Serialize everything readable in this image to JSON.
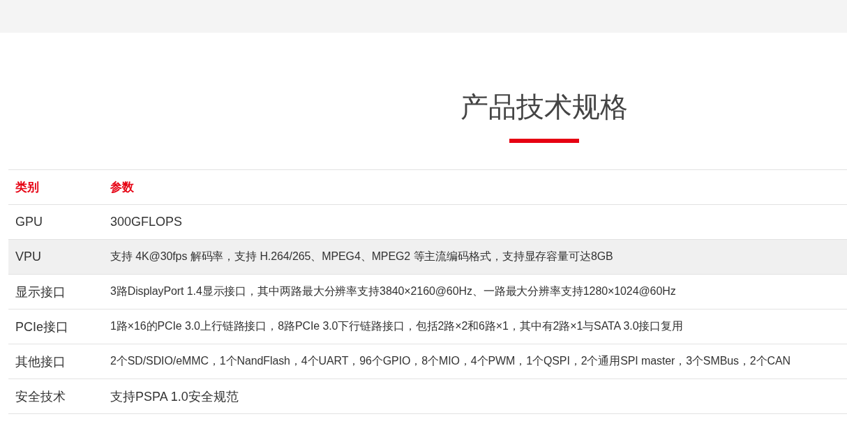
{
  "title": "产品技术规格",
  "table": {
    "columns": [
      "类别",
      "参数"
    ],
    "rows": [
      {
        "category": "GPU",
        "value": "300GFLOPS",
        "kind": "normal",
        "highlighted": false
      },
      {
        "category": "VPU",
        "value": "支持 4K@30fps 解码率，支持 H.264/265、MPEG4、MPEG2 等主流编码格式，支持显存容量可达8GB",
        "kind": "compact",
        "highlighted": true
      },
      {
        "category": "显示接口",
        "value": "3路DisplayPort 1.4显示接口，其中两路最大分辨率支持3840×2160@60Hz、一路最大分辨率支持1280×1024@60Hz",
        "kind": "compact",
        "highlighted": false
      },
      {
        "category": "PCIe接口",
        "value": "1路×16的PCIe 3.0上行链路接口，8路PCIe 3.0下行链路接口，包括2路×2和6路×1，其中有2路×1与SATA 3.0接口复用",
        "kind": "compact",
        "highlighted": false
      },
      {
        "category": "其他接口",
        "value": "2个SD/SDIO/eMMC，1个NandFlash，4个UART，96个GPIO，8个MIO，4个PWM，1个QSPI，2个通用SPI master，3个SMBus，2个CAN",
        "kind": "compact",
        "highlighted": false
      },
      {
        "category": "安全技术",
        "value": "支持PSPA 1.0安全规范",
        "kind": "normal",
        "highlighted": false
      }
    ]
  }
}
